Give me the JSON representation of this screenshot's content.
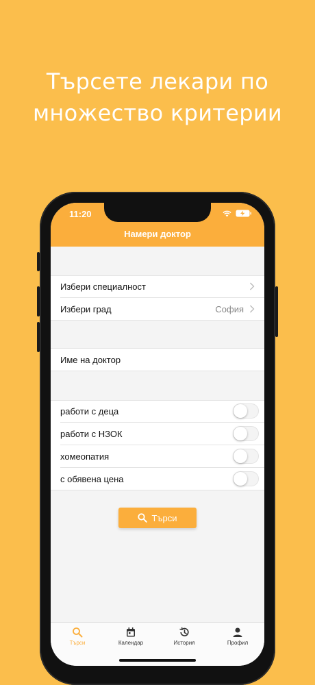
{
  "headline": {
    "line1": "Търсете лекари по",
    "line2": "множество критерии"
  },
  "status": {
    "time": "11:20"
  },
  "nav": {
    "title": "Намери доктор"
  },
  "filters": {
    "specialty_label": "Избери специалност",
    "city_label": "Избери град",
    "city_value": "София",
    "doctor_name_label": "Име на доктор"
  },
  "toggles": [
    {
      "label": "работи с деца",
      "on": false
    },
    {
      "label": "работи с НЗОК",
      "on": false
    },
    {
      "label": "хомеопатия",
      "on": false
    },
    {
      "label": "с обявена цена",
      "on": false
    }
  ],
  "search_button": {
    "label": "Търси"
  },
  "tabs": [
    {
      "label": "Търси",
      "icon": "search-icon",
      "active": true
    },
    {
      "label": "Календар",
      "icon": "calendar-icon",
      "active": false
    },
    {
      "label": "История",
      "icon": "history-icon",
      "active": false
    },
    {
      "label": "Профил",
      "icon": "profile-icon",
      "active": false
    }
  ],
  "colors": {
    "background": "#FBBE4C",
    "accent": "#FBAE3C"
  }
}
